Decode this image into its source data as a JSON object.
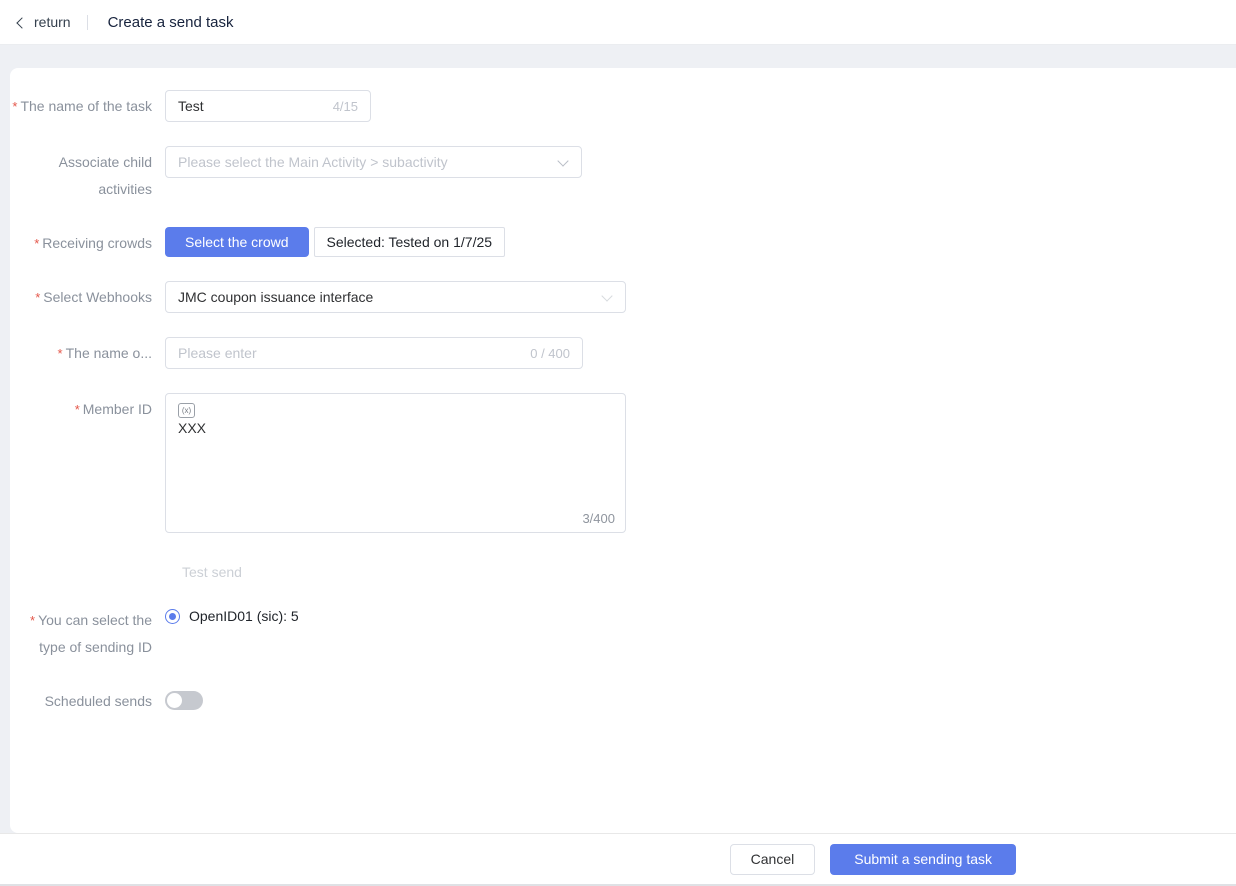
{
  "colors": {
    "accent": "#5b7ceb",
    "required_mark": "#e45649",
    "page_bg": "#eef0f4"
  },
  "required_mark": "*",
  "header": {
    "back_label": "return",
    "title": "Create a send task"
  },
  "form": {
    "task_name": {
      "label": "The name of the task",
      "value": "Test",
      "counter": "4/15"
    },
    "child_activities": {
      "label": "Associate child activities",
      "placeholder": "Please select the Main Activity > subactivity"
    },
    "receiving_crowds": {
      "label": "Receiving crowds",
      "button": "Select the crowd",
      "selected": "Selected: Tested on 1/7/25"
    },
    "webhooks": {
      "label": "Select Webhooks",
      "value": "JMC coupon issuance interface"
    },
    "message_name": {
      "label": "The name o...",
      "placeholder": "Please enter",
      "counter": "0 / 400"
    },
    "member_id": {
      "label": "Member ID",
      "chip": "(x)",
      "value": "XXX",
      "counter": "3/400"
    },
    "test_send": {
      "label": "Test send"
    },
    "sending_id": {
      "label": "You can select the type of sending ID",
      "option": "OpenID01 (sic): 5"
    },
    "scheduled_sends": {
      "label": "Scheduled sends"
    }
  },
  "footer": {
    "cancel": "Cancel",
    "submit": "Submit a sending task"
  }
}
